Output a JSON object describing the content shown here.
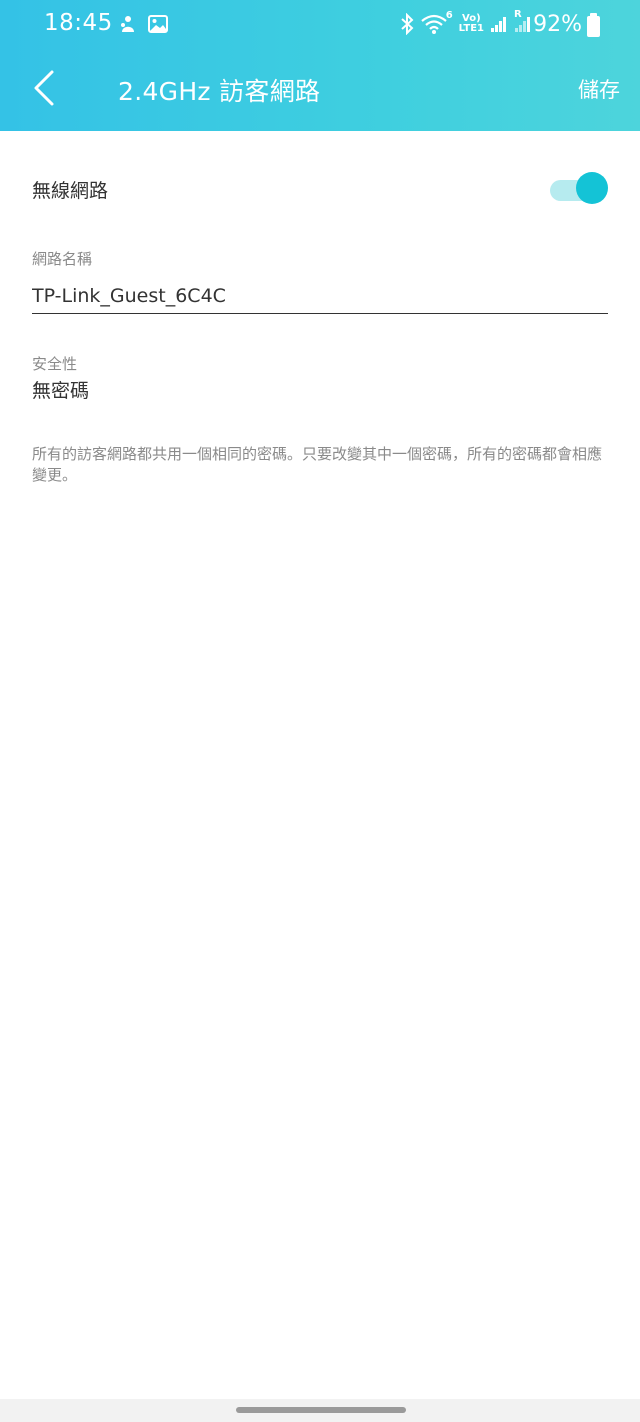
{
  "status_bar": {
    "time": "18:45",
    "network_top": "Vo)",
    "network_bottom": "LTE1",
    "wifi_badge": "6",
    "roaming_badge": "R",
    "battery_percent": "92%",
    "icons": [
      "mascot-notification-icon",
      "gallery-icon",
      "bluetooth-icon",
      "wifi-icon",
      "signal-icon",
      "signal-roaming-icon",
      "battery-icon"
    ]
  },
  "app_bar": {
    "title": "2.4GHz 訪客網路",
    "save_label": "儲存",
    "accent_color": "#3fcfdf"
  },
  "wireless": {
    "label": "無線網路",
    "enabled": true,
    "toggle_color": "#14c3d6"
  },
  "ssid": {
    "label": "網路名稱",
    "value": "TP-Link_Guest_6C4C"
  },
  "security": {
    "label": "安全性",
    "value": "無密碼"
  },
  "note": "所有的訪客網路都共用一個相同的密碼。只要改變其中一個密碼，所有的密碼都會相應變更。"
}
